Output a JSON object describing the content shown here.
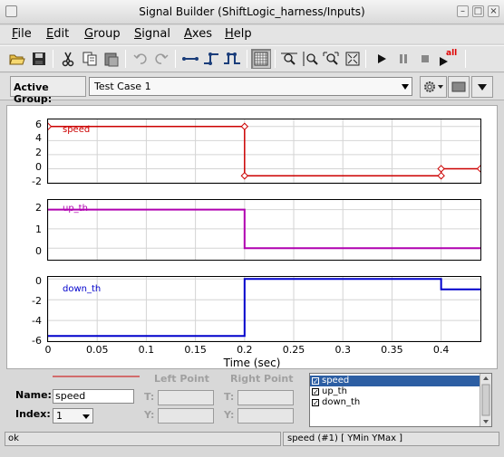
{
  "window": {
    "title": "Signal Builder (ShiftLogic_harness/Inputs)"
  },
  "menu": {
    "items": [
      {
        "u": "F",
        "rest": "ile"
      },
      {
        "u": "E",
        "rest": "dit"
      },
      {
        "u": "G",
        "rest": "roup"
      },
      {
        "u": "S",
        "rest": "ignal"
      },
      {
        "u": "A",
        "rest": "xes"
      },
      {
        "u": "H",
        "rest": "elp"
      }
    ]
  },
  "toolbar": {
    "icons": [
      "open-folder-icon",
      "save-icon",
      "cut-icon",
      "copy-icon",
      "paste-icon",
      "undo-icon",
      "redo-icon",
      "insert-constant-icon",
      "insert-step-icon",
      "insert-pulse-icon",
      "grid-icon",
      "zoom-x-icon",
      "zoom-y-icon",
      "zoom-xy-icon",
      "fit-view-icon",
      "play-icon",
      "pause-icon",
      "stop-icon",
      "run-all-icon"
    ],
    "run_all_label": "all"
  },
  "group": {
    "label": "Active Group:",
    "value": "Test Case 1"
  },
  "colors": {
    "speed": "#cc0000",
    "up_th": "#b000b0",
    "down_th": "#0000cc",
    "selection": "#2c5ea3"
  },
  "chart_data": [
    {
      "type": "line",
      "series": [
        {
          "name": "speed",
          "x": [
            0,
            0.2,
            0.2,
            0.4,
            0.4,
            0.44
          ],
          "y": [
            6,
            6,
            -1,
            -1,
            0,
            0
          ]
        }
      ],
      "ylim": [
        -2,
        7
      ],
      "yticks": [
        "6",
        "4",
        "2",
        "0",
        "-2"
      ],
      "grid": true
    },
    {
      "type": "line",
      "series": [
        {
          "name": "up_th",
          "x": [
            0,
            0.2,
            0.2,
            0.44
          ],
          "y": [
            2,
            2,
            0,
            0
          ]
        }
      ],
      "ylim": [
        -0.6,
        2.5
      ],
      "yticks": [
        "2",
        "1",
        "0"
      ],
      "grid": true
    },
    {
      "type": "line",
      "series": [
        {
          "name": "down_th",
          "x": [
            0,
            0.2,
            0.2,
            0.4,
            0.4,
            0.44
          ],
          "y": [
            -5.5,
            -5.5,
            0,
            0,
            -1,
            -1
          ]
        }
      ],
      "ylim": [
        -6,
        0.2
      ],
      "yticks": [
        "0",
        "-2",
        "-4",
        "-6"
      ],
      "grid": true
    }
  ],
  "xaxis": {
    "label": "Time (sec)",
    "ticks": [
      "0",
      "0.05",
      "0.1",
      "0.15",
      "0.2",
      "0.25",
      "0.3",
      "0.35",
      "0.4"
    ],
    "xlim": [
      0,
      0.44
    ]
  },
  "panel": {
    "left_point": "Left Point",
    "right_point": "Right Point",
    "t_label": "T:",
    "y_label": "Y:",
    "name_label": "Name:",
    "name_value": "speed",
    "index_label": "Index:",
    "index_value": "1"
  },
  "signals": [
    {
      "label": "speed",
      "checked": true,
      "selected": true
    },
    {
      "label": "up_th",
      "checked": true,
      "selected": false
    },
    {
      "label": "down_th",
      "checked": true,
      "selected": false
    }
  ],
  "status": {
    "left": "ok",
    "right": "speed (#1)  [ YMin YMax ]"
  }
}
